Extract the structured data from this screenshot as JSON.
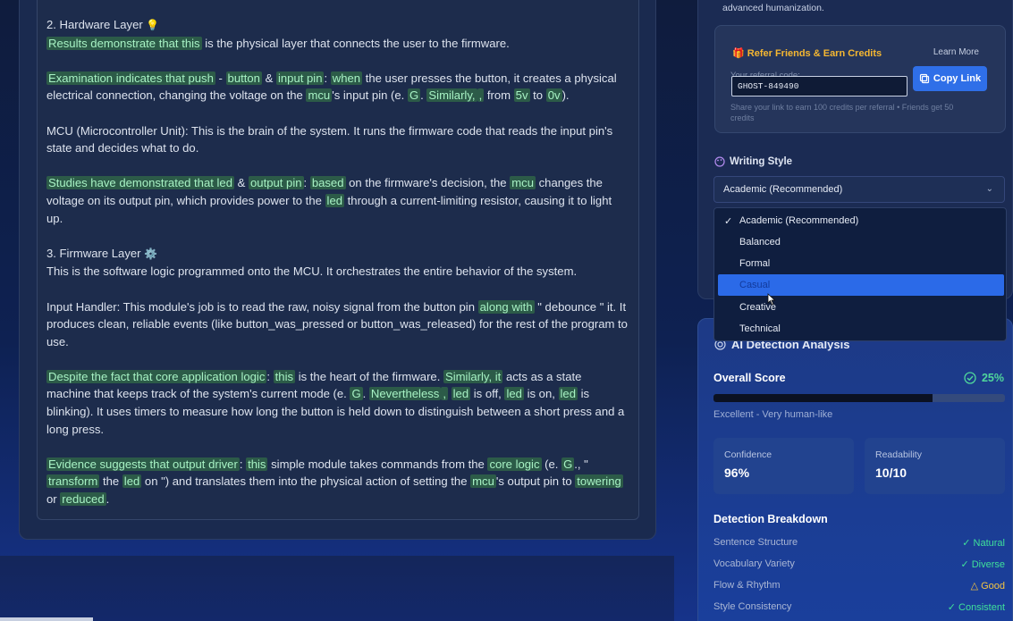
{
  "document": {
    "hardware_heading": "2. Hardware Layer",
    "hw_p1": {
      "hl": "Results demonstrate that this",
      "rest": "is the physical layer that connects the user to the firmware."
    },
    "hw_p2": {
      "h1": "Examination indicates that push",
      "t1": "-",
      "h2": "button",
      "t2": "&",
      "h3": "input pin",
      "t3": ":",
      "h4": "when",
      "t4": "the user presses the button, it creates a physical electrical connection, changing the voltage on the",
      "h5": "mcu",
      "t5": "'s input pin (e.",
      "h6": "G",
      "t6": ".",
      "h7": "Similarly,",
      "h8": ",",
      "t7": "from",
      "h9": "5v",
      "t8": "to",
      "h10": "0v",
      "t9": ")."
    },
    "hw_p3": "MCU (Microcontroller Unit): This is the brain of the system. It runs the firmware code that reads the input pin's state and decides what to do.",
    "hw_p4": {
      "h1": "Studies have demonstrated that led",
      "t1": "&",
      "h2": "output pin",
      "t2": ":",
      "h3": "based",
      "t3": "on the firmware's decision, the",
      "h4": "mcu",
      "t4": "changes the voltage on its output pin, which provides power to the",
      "h5": "led",
      "t5": "through a current-limiting resistor, causing it to light up."
    },
    "firmware_heading": "3. Firmware Layer",
    "fw_intro": "This is the software logic programmed onto the MCU. It orchestrates the entire behavior of the system.",
    "fw_p2": {
      "t1": "Input Handler: This module's job is to read the raw, noisy signal from the button pin",
      "h1": "along with",
      "t2": "\" debounce \" it. It produces clean, reliable events (like button_was_pressed or button_was_released) for the rest of the program to use."
    },
    "fw_p3": {
      "h1": "Despite the fact that core application logic",
      "t1": ":",
      "h2": "this",
      "t2": "is the heart of the firmware.",
      "h3": "Similarly, it",
      "t3": "acts as a state machine that keeps track of the system's current mode (e.",
      "h4": "G",
      "t4": ".",
      "h5": "Nevertheless",
      "h6": ",",
      "h7": "led",
      "t5": "is off,",
      "h8": "led",
      "t6": "is on,",
      "h9": "led",
      "t7": "is blinking). It uses timers to measure how long the button is held down to distinguish between a short press and a long press."
    },
    "fw_p4": {
      "h1": "Evidence suggests that output driver",
      "t1": ":",
      "h2": "this",
      "t2": "simple module takes commands from the",
      "h3": "core logic",
      "t3": "(e.",
      "h4": "G",
      "t4": "., \"",
      "h5": "transform",
      "t5": "the",
      "h6": "led",
      "t6": "on \") and translates them into the physical action of setting the",
      "h7": "mcu",
      "t7": "'s output pin to",
      "h8": "towering",
      "t8": "or",
      "h9": "reduced",
      "t9": "."
    }
  },
  "sidebar": {
    "plan_note": "advanced humanization.",
    "referral": {
      "title": "Refer Friends & Earn Credits",
      "learn_more": "Learn More",
      "code_label": "Your referral code:",
      "code": "GHOST-849490",
      "copy_button": "Copy Link",
      "help": "Share your link to earn 100 credits per referral • Friends get 50 credits"
    },
    "writing_style": {
      "title": "Writing Style",
      "selected": "Academic (Recommended)",
      "options": [
        "Academic (Recommended)",
        "Balanced",
        "Formal",
        "Casual",
        "Creative",
        "Technical"
      ],
      "highlighted_index": 3
    },
    "ai_detection": {
      "title": "AI Detection Analysis",
      "overall_label": "Overall Score",
      "overall_value": "25%",
      "overall_fraction": 0.75,
      "description": "Excellent - Very human-like",
      "confidence_label": "Confidence",
      "confidence_value": "96%",
      "readability_label": "Readability",
      "readability_value": "10/10",
      "breakdown_title": "Detection Breakdown",
      "breakdown": [
        {
          "label": "Sentence Structure",
          "result": "✓ Natural",
          "status": "green"
        },
        {
          "label": "Vocabulary Variety",
          "result": "✓ Diverse",
          "status": "green"
        },
        {
          "label": "Flow & Rhythm",
          "result": "△ Good",
          "status": "yellow"
        },
        {
          "label": "Style Consistency",
          "result": "✓ Consistent",
          "status": "green"
        }
      ]
    }
  },
  "colors": {
    "accent": "#2f6fe8",
    "highlight_bg": "#2c5b48",
    "success": "#3fe09a",
    "warning": "#f4c442"
  }
}
